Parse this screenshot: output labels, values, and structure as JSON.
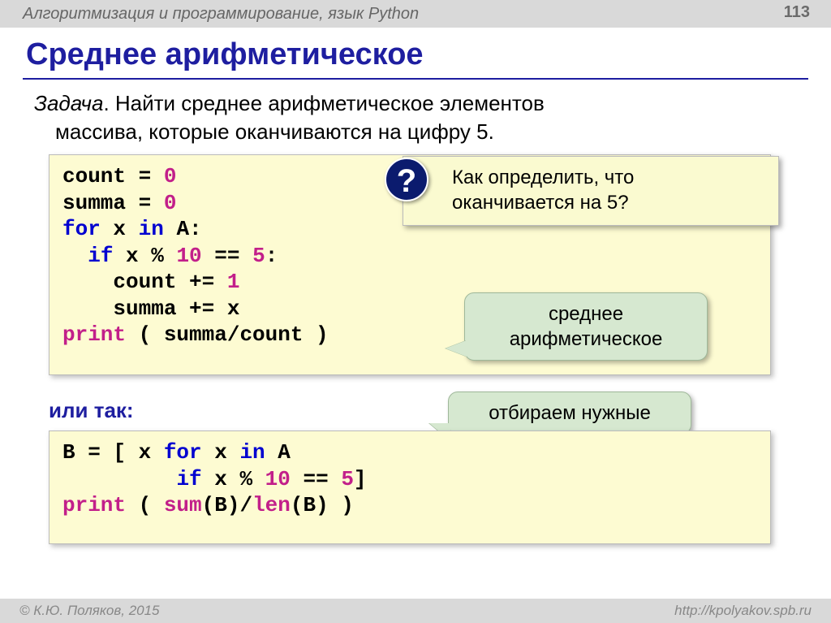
{
  "header": {
    "course": "Алгоритмизация и программирование, язык Python",
    "page": "113"
  },
  "title": "Среднее арифметическое",
  "task": {
    "label": "Задача",
    "text1": ". Найти среднее арифметическое элементов",
    "text2": "массива, которые оканчиваются на цифру 5."
  },
  "code1": {
    "l1_a": "count",
    "l1_b": " = ",
    "l1_c": "0",
    "l2_a": "summa",
    "l2_b": " = ",
    "l2_c": "0",
    "l3_a": "for",
    "l3_b": " x ",
    "l3_c": "in",
    "l3_d": " A:",
    "l4_a": "  ",
    "l4_b": "if",
    "l4_c": " x % ",
    "l4_d": "10",
    "l4_e": " == ",
    "l4_f": "5",
    "l4_g": ":",
    "l5_a": "    count += ",
    "l5_b": "1",
    "l6_a": "    summa += x",
    "l7_a": "print",
    "l7_b": " ( summa/count )"
  },
  "or_label": "или так:",
  "code2": {
    "l1_a": "B = [ x ",
    "l1_b": "for",
    "l1_c": " x ",
    "l1_d": "in",
    "l1_e": " A",
    "l2_a": "         ",
    "l2_b": "if",
    "l2_c": " x % ",
    "l2_d": "10",
    "l2_e": " == ",
    "l2_f": "5",
    "l2_g": "]",
    "l3_a": "print",
    "l3_b": " ( ",
    "l3_c": "sum",
    "l3_d": "(B)/",
    "l3_e": "len",
    "l3_f": "(B) )"
  },
  "question": {
    "badge": "?",
    "line1": "Как определить, что",
    "line2": "оканчивается на 5?"
  },
  "callouts": {
    "avg": "среднее арифметическое",
    "filter": "отбираем нужные"
  },
  "footer": {
    "left": "© К.Ю. Поляков, 2015",
    "right": "http://kpolyakov.spb.ru"
  }
}
